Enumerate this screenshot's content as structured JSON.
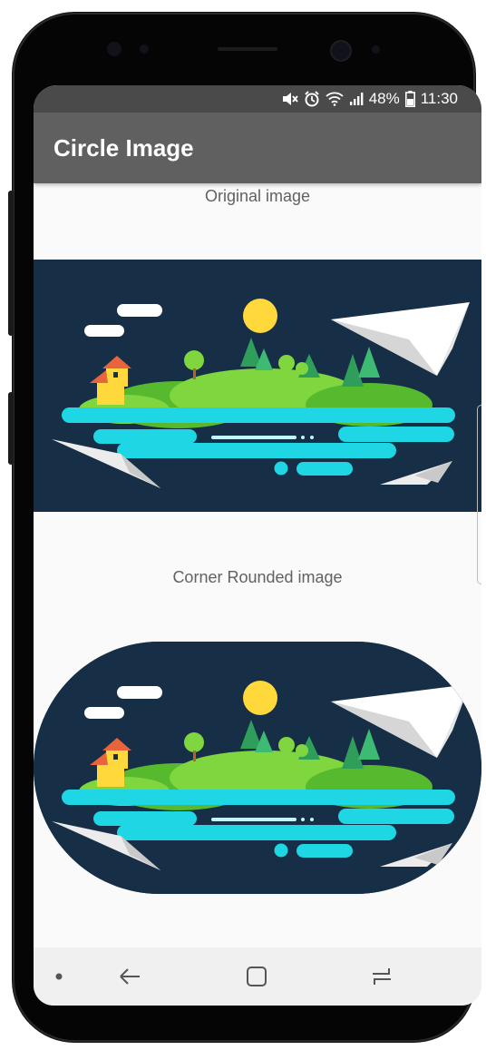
{
  "status_bar": {
    "battery": "48%",
    "time": "11:30",
    "icons": [
      "mute-icon",
      "alarm-icon",
      "wifi-icon",
      "signal-icon",
      "battery-icon"
    ]
  },
  "app_bar": {
    "title": "Circle Image"
  },
  "sections": [
    {
      "caption": "Original image",
      "image_icon": "landscape-illustration"
    },
    {
      "caption": "Corner Rounded image",
      "image_icon": "landscape-illustration"
    }
  ],
  "nav_bar": {
    "icons": [
      "dot-icon",
      "back-icon",
      "home-icon",
      "recents-icon"
    ]
  },
  "colors": {
    "app_bar": "#606060",
    "status_bar": "#4a4a4a",
    "image_background": "#162e46",
    "water": "#1ed6e4",
    "grass": "#6fd23a"
  }
}
